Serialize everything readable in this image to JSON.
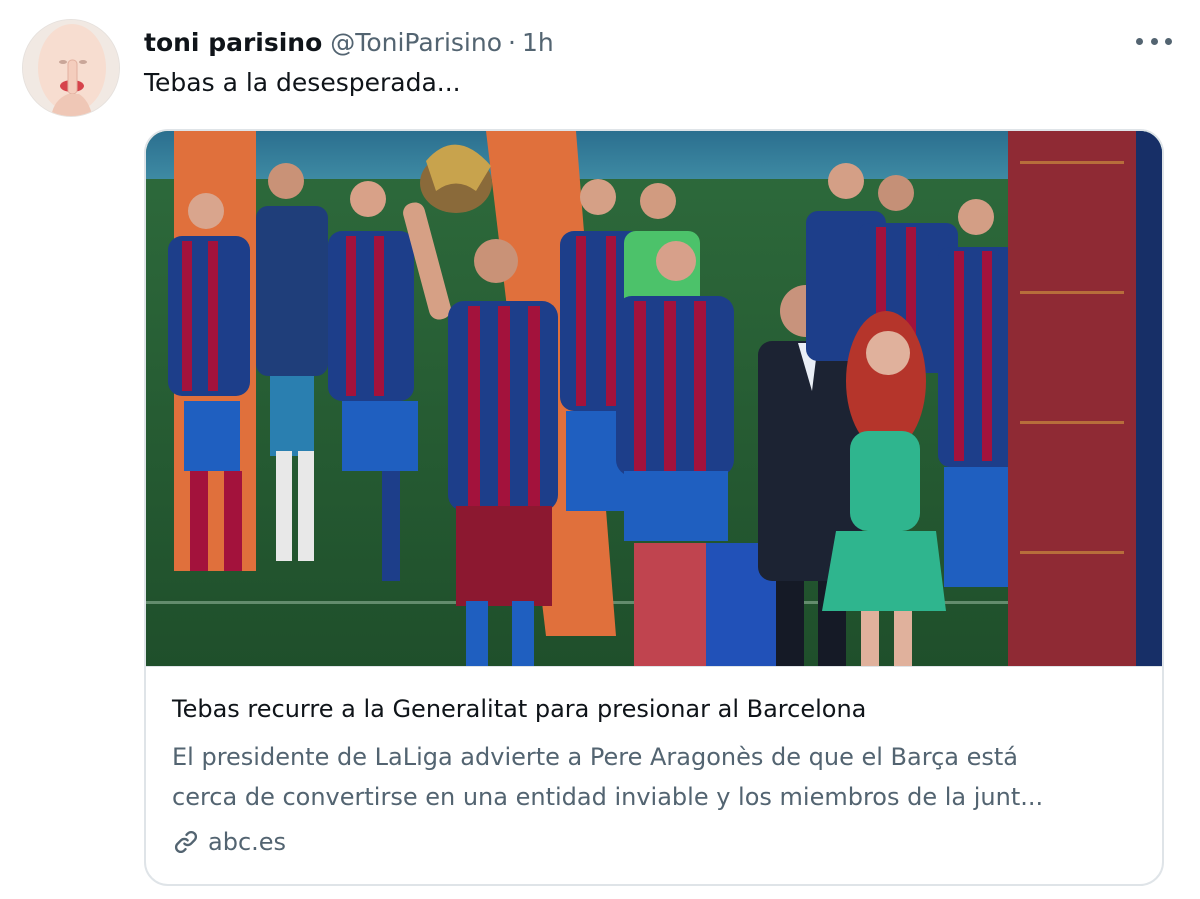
{
  "tweet": {
    "author": {
      "display_name": "toni parisino",
      "handle": "@ToniParisino",
      "separator": "·",
      "time": "1h",
      "avatar_icon": "avatar-shush-gesture"
    },
    "text": "Tebas a la desesperada...",
    "more_icon": "more-horizontal-icon",
    "card": {
      "image_icon": "trophy-celebration-photo",
      "title": "Tebas recurre a la Generalitat para presionar al Barcelona",
      "description_line1": "El presidente de LaLiga advierte a Pere Aragonès de que el Barça está",
      "description_line2": "cerca de convertirse en una entidad inviable y los miembros de la junt...",
      "domain": "abc.es",
      "link_icon": "link-icon"
    }
  },
  "colors": {
    "text_primary": "#0f1419",
    "text_secondary": "#536471",
    "border": "#dfe4e8",
    "kit_blue": "#1d3e8a",
    "kit_garnet": "#a3123c"
  }
}
